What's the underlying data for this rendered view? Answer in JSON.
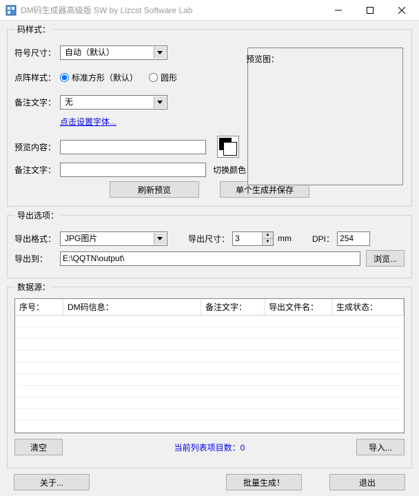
{
  "window": {
    "title": "DM码生成器高级版 SW  by Lizcst Software Lab"
  },
  "style_section": {
    "legend": "码样式：",
    "symbol_size_label": "符号尺寸：",
    "symbol_size_value": "自动（默认）",
    "dot_style_label": "点阵样式：",
    "radio_square": "标准方形（默认）",
    "radio_circle": "圆形",
    "note_text_label": "备注文字：",
    "note_text_value": "无",
    "font_link": "点击设置字体...",
    "preview_content_label": "预览内容：",
    "preview_content_value": "",
    "note_text2_label": "备注文字：",
    "note_text2_value": "",
    "preview_label": "预览图：",
    "swap_color_label": "切换颜色",
    "refresh_btn": "刷新预览",
    "save_btn": "单个生成并保存"
  },
  "export_section": {
    "legend": "导出选项：",
    "format_label": "导出格式：",
    "format_value": "JPG图片",
    "size_label": "导出尺寸：",
    "size_value": "3",
    "size_unit": "mm",
    "dpi_label": "DPI：",
    "dpi_value": "254",
    "dest_label": "导出到：",
    "dest_value": "E:\\QQTN\\output\\",
    "browse_btn": "浏览..."
  },
  "data_section": {
    "legend": "数据源：",
    "col_seq": "序号：",
    "col_info": "DM码信息：",
    "col_note": "备注文字：",
    "col_filename": "导出文件名：",
    "col_status": "生成状态：",
    "clear_btn": "清空",
    "count_label": "当前列表项目数：",
    "count_value": "0",
    "import_btn": "导入..."
  },
  "bottom": {
    "about_btn": "关于...",
    "batch_btn": "批量生成！",
    "exit_btn": "退出"
  }
}
